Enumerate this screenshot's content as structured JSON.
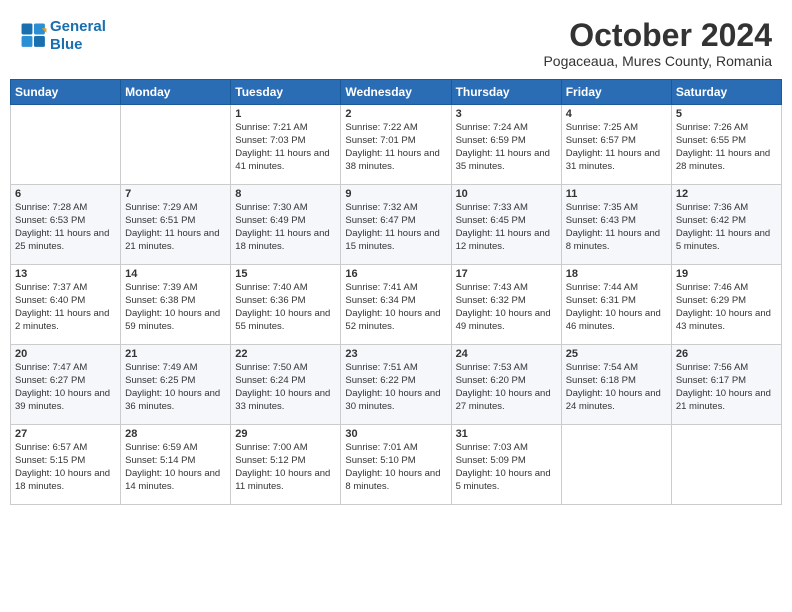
{
  "header": {
    "logo_line1": "General",
    "logo_line2": "Blue",
    "main_title": "October 2024",
    "subtitle": "Pogaceaua, Mures County, Romania"
  },
  "calendar": {
    "headers": [
      "Sunday",
      "Monday",
      "Tuesday",
      "Wednesday",
      "Thursday",
      "Friday",
      "Saturday"
    ],
    "weeks": [
      [
        {
          "day": "",
          "content": ""
        },
        {
          "day": "",
          "content": ""
        },
        {
          "day": "1",
          "content": "Sunrise: 7:21 AM\nSunset: 7:03 PM\nDaylight: 11 hours and 41 minutes."
        },
        {
          "day": "2",
          "content": "Sunrise: 7:22 AM\nSunset: 7:01 PM\nDaylight: 11 hours and 38 minutes."
        },
        {
          "day": "3",
          "content": "Sunrise: 7:24 AM\nSunset: 6:59 PM\nDaylight: 11 hours and 35 minutes."
        },
        {
          "day": "4",
          "content": "Sunrise: 7:25 AM\nSunset: 6:57 PM\nDaylight: 11 hours and 31 minutes."
        },
        {
          "day": "5",
          "content": "Sunrise: 7:26 AM\nSunset: 6:55 PM\nDaylight: 11 hours and 28 minutes."
        }
      ],
      [
        {
          "day": "6",
          "content": "Sunrise: 7:28 AM\nSunset: 6:53 PM\nDaylight: 11 hours and 25 minutes."
        },
        {
          "day": "7",
          "content": "Sunrise: 7:29 AM\nSunset: 6:51 PM\nDaylight: 11 hours and 21 minutes."
        },
        {
          "day": "8",
          "content": "Sunrise: 7:30 AM\nSunset: 6:49 PM\nDaylight: 11 hours and 18 minutes."
        },
        {
          "day": "9",
          "content": "Sunrise: 7:32 AM\nSunset: 6:47 PM\nDaylight: 11 hours and 15 minutes."
        },
        {
          "day": "10",
          "content": "Sunrise: 7:33 AM\nSunset: 6:45 PM\nDaylight: 11 hours and 12 minutes."
        },
        {
          "day": "11",
          "content": "Sunrise: 7:35 AM\nSunset: 6:43 PM\nDaylight: 11 hours and 8 minutes."
        },
        {
          "day": "12",
          "content": "Sunrise: 7:36 AM\nSunset: 6:42 PM\nDaylight: 11 hours and 5 minutes."
        }
      ],
      [
        {
          "day": "13",
          "content": "Sunrise: 7:37 AM\nSunset: 6:40 PM\nDaylight: 11 hours and 2 minutes."
        },
        {
          "day": "14",
          "content": "Sunrise: 7:39 AM\nSunset: 6:38 PM\nDaylight: 10 hours and 59 minutes."
        },
        {
          "day": "15",
          "content": "Sunrise: 7:40 AM\nSunset: 6:36 PM\nDaylight: 10 hours and 55 minutes."
        },
        {
          "day": "16",
          "content": "Sunrise: 7:41 AM\nSunset: 6:34 PM\nDaylight: 10 hours and 52 minutes."
        },
        {
          "day": "17",
          "content": "Sunrise: 7:43 AM\nSunset: 6:32 PM\nDaylight: 10 hours and 49 minutes."
        },
        {
          "day": "18",
          "content": "Sunrise: 7:44 AM\nSunset: 6:31 PM\nDaylight: 10 hours and 46 minutes."
        },
        {
          "day": "19",
          "content": "Sunrise: 7:46 AM\nSunset: 6:29 PM\nDaylight: 10 hours and 43 minutes."
        }
      ],
      [
        {
          "day": "20",
          "content": "Sunrise: 7:47 AM\nSunset: 6:27 PM\nDaylight: 10 hours and 39 minutes."
        },
        {
          "day": "21",
          "content": "Sunrise: 7:49 AM\nSunset: 6:25 PM\nDaylight: 10 hours and 36 minutes."
        },
        {
          "day": "22",
          "content": "Sunrise: 7:50 AM\nSunset: 6:24 PM\nDaylight: 10 hours and 33 minutes."
        },
        {
          "day": "23",
          "content": "Sunrise: 7:51 AM\nSunset: 6:22 PM\nDaylight: 10 hours and 30 minutes."
        },
        {
          "day": "24",
          "content": "Sunrise: 7:53 AM\nSunset: 6:20 PM\nDaylight: 10 hours and 27 minutes."
        },
        {
          "day": "25",
          "content": "Sunrise: 7:54 AM\nSunset: 6:18 PM\nDaylight: 10 hours and 24 minutes."
        },
        {
          "day": "26",
          "content": "Sunrise: 7:56 AM\nSunset: 6:17 PM\nDaylight: 10 hours and 21 minutes."
        }
      ],
      [
        {
          "day": "27",
          "content": "Sunrise: 6:57 AM\nSunset: 5:15 PM\nDaylight: 10 hours and 18 minutes."
        },
        {
          "day": "28",
          "content": "Sunrise: 6:59 AM\nSunset: 5:14 PM\nDaylight: 10 hours and 14 minutes."
        },
        {
          "day": "29",
          "content": "Sunrise: 7:00 AM\nSunset: 5:12 PM\nDaylight: 10 hours and 11 minutes."
        },
        {
          "day": "30",
          "content": "Sunrise: 7:01 AM\nSunset: 5:10 PM\nDaylight: 10 hours and 8 minutes."
        },
        {
          "day": "31",
          "content": "Sunrise: 7:03 AM\nSunset: 5:09 PM\nDaylight: 10 hours and 5 minutes."
        },
        {
          "day": "",
          "content": ""
        },
        {
          "day": "",
          "content": ""
        }
      ]
    ]
  }
}
